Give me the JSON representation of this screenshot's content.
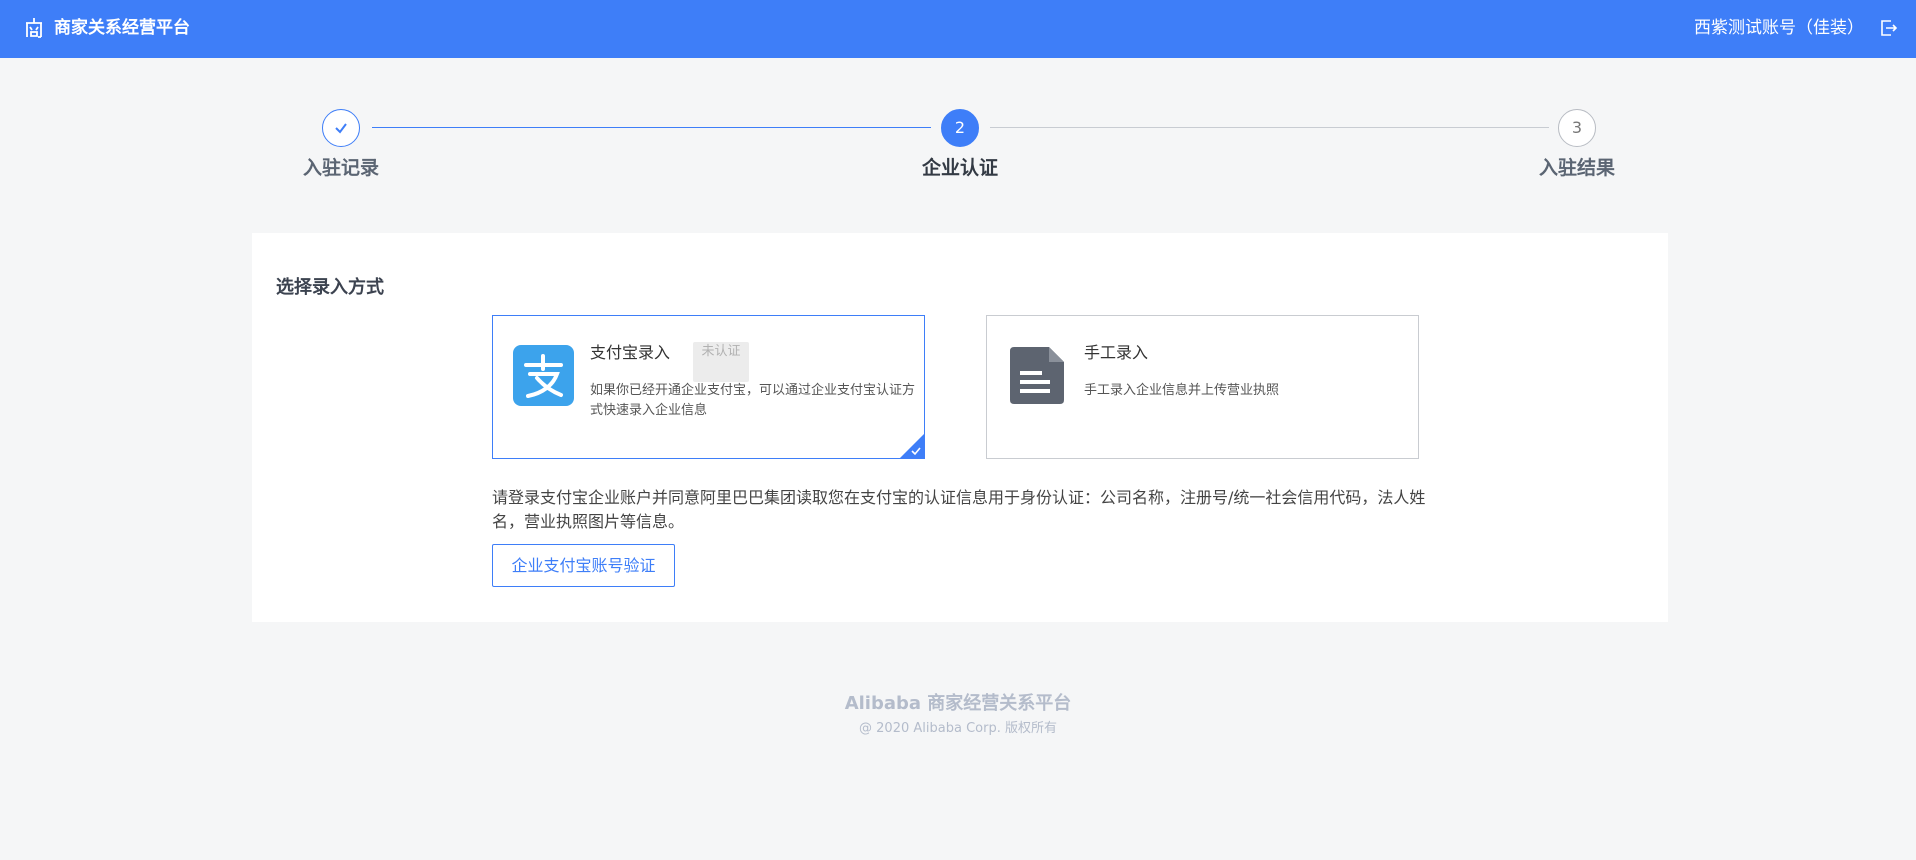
{
  "header": {
    "app_title": "商家关系经营平台",
    "account": "西紫测试账号（佳装）",
    "logo_icon": "shop-logo-icon",
    "logout_icon": "logout-icon"
  },
  "steps": [
    {
      "number": "1",
      "label": "入驻记录",
      "status": "done"
    },
    {
      "number": "2",
      "label": "企业认证",
      "status": "active"
    },
    {
      "number": "3",
      "label": "入驻结果",
      "status": "todo"
    }
  ],
  "section_title": "选择录入方式",
  "options": {
    "alipay": {
      "title": "支付宝录入",
      "badge": "未认证",
      "desc": "如果你已经开通企业支付宝，可以通过企业支付宝认证方式快速录入企业信息",
      "icon": "alipay-icon",
      "selected": true
    },
    "manual": {
      "title": "手工录入",
      "desc": "手工录入企业信息并上传营业执照",
      "icon": "document-icon",
      "selected": false
    }
  },
  "notice": "请登录支付宝企业账户并同意阿里巴巴集团读取您在支付宝的认证信息用于身份认证：公司名称，注册号/统一社会信用代码，法人姓名，营业执照图片等信息。",
  "verify_button": "企业支付宝账号验证",
  "footer": {
    "title": "Alibaba 商家经营关系平台",
    "copyright": "@ 2020 Alibaba Corp. 版权所有"
  },
  "colors": {
    "primary": "#3e7ef8",
    "alipay": "#3ca3ec",
    "doc_icon": "#5d6470"
  }
}
